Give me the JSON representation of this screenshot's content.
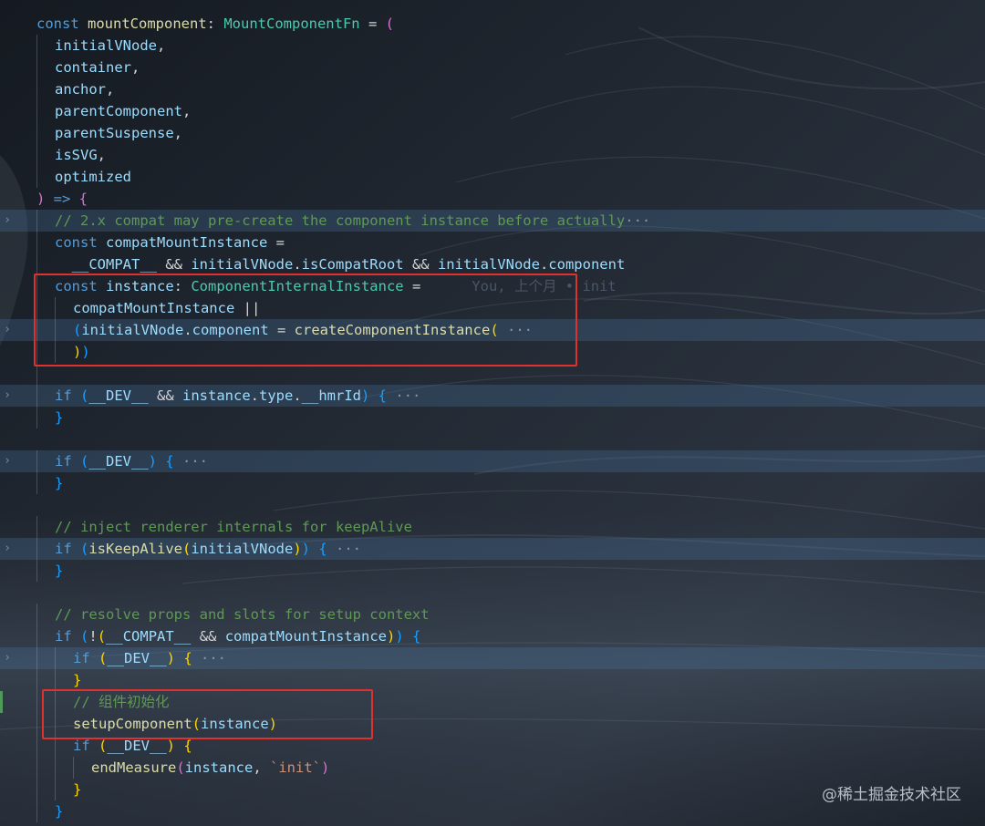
{
  "editor": {
    "lines": [
      {
        "tokens": [
          {
            "t": "const ",
            "c": "kw"
          },
          {
            "t": "mountComponent",
            "c": "fn"
          },
          {
            "t": ": ",
            "c": "pu"
          },
          {
            "t": "MountComponentFn",
            "c": "ty"
          },
          {
            "t": " = ",
            "c": "pu"
          },
          {
            "t": "(",
            "c": "b2"
          }
        ]
      },
      {
        "indent": 1,
        "tokens": [
          {
            "t": "initialVNode",
            "c": "var"
          },
          {
            "t": ",",
            "c": "pu"
          }
        ]
      },
      {
        "indent": 1,
        "tokens": [
          {
            "t": "container",
            "c": "var"
          },
          {
            "t": ",",
            "c": "pu"
          }
        ]
      },
      {
        "indent": 1,
        "tokens": [
          {
            "t": "anchor",
            "c": "var"
          },
          {
            "t": ",",
            "c": "pu"
          }
        ]
      },
      {
        "indent": 1,
        "tokens": [
          {
            "t": "parentComponent",
            "c": "var"
          },
          {
            "t": ",",
            "c": "pu"
          }
        ]
      },
      {
        "indent": 1,
        "tokens": [
          {
            "t": "parentSuspense",
            "c": "var"
          },
          {
            "t": ",",
            "c": "pu"
          }
        ]
      },
      {
        "indent": 1,
        "tokens": [
          {
            "t": "isSVG",
            "c": "var"
          },
          {
            "t": ",",
            "c": "pu"
          }
        ]
      },
      {
        "indent": 1,
        "tokens": [
          {
            "t": "optimized",
            "c": "var"
          }
        ]
      },
      {
        "tokens": [
          {
            "t": ")",
            "c": "b2"
          },
          {
            "t": " => ",
            "c": "kw"
          },
          {
            "t": "{",
            "c": "b2"
          }
        ]
      },
      {
        "indent": 1,
        "fold": true,
        "hl": true,
        "tokens": [
          {
            "t": "// 2.x compat may pre-create the component instance before actually",
            "c": "cm"
          },
          {
            "t": "···",
            "c": "fd"
          }
        ]
      },
      {
        "indent": 1,
        "tokens": [
          {
            "t": "const ",
            "c": "kw"
          },
          {
            "t": "compatMountInstance",
            "c": "var"
          },
          {
            "t": " =",
            "c": "pu"
          }
        ]
      },
      {
        "indent": 1,
        "tokens": [
          {
            "t": "  __COMPAT__ ",
            "c": "var"
          },
          {
            "t": "&& ",
            "c": "pu"
          },
          {
            "t": "initialVNode",
            "c": "var"
          },
          {
            "t": ".",
            "c": "pu"
          },
          {
            "t": "isCompatRoot",
            "c": "var"
          },
          {
            "t": " && ",
            "c": "pu"
          },
          {
            "t": "initialVNode",
            "c": "var"
          },
          {
            "t": ".",
            "c": "pu"
          },
          {
            "t": "component",
            "c": "var"
          }
        ]
      },
      {
        "indent": 1,
        "tokens": [
          {
            "t": "const ",
            "c": "kw"
          },
          {
            "t": "instance",
            "c": "var"
          },
          {
            "t": ": ",
            "c": "pu"
          },
          {
            "t": "ComponentInternalInstance",
            "c": "ty"
          },
          {
            "t": " =",
            "c": "pu"
          },
          {
            "t": "      You, 上个月 • init",
            "c": "blame"
          }
        ]
      },
      {
        "indent": 2,
        "tokens": [
          {
            "t": "compatMountInstance",
            "c": "var"
          },
          {
            "t": " ||",
            "c": "pu"
          }
        ]
      },
      {
        "indent": 2,
        "fold": true,
        "hl": true,
        "tokens": [
          {
            "t": "(",
            "c": "b3"
          },
          {
            "t": "initialVNode",
            "c": "var"
          },
          {
            "t": ".",
            "c": "pu"
          },
          {
            "t": "component",
            "c": "var"
          },
          {
            "t": " = ",
            "c": "pu"
          },
          {
            "t": "createComponentInstance",
            "c": "fn"
          },
          {
            "t": "(",
            "c": "b1"
          },
          {
            "t": " ···",
            "c": "fd"
          }
        ]
      },
      {
        "indent": 2,
        "tokens": [
          {
            "t": ")",
            "c": "b1"
          },
          {
            "t": ")",
            "c": "b3"
          }
        ]
      },
      {
        "indent": 1,
        "tokens": []
      },
      {
        "indent": 1,
        "fold": true,
        "hl": true,
        "tokens": [
          {
            "t": "if ",
            "c": "ctl"
          },
          {
            "t": "(",
            "c": "b3"
          },
          {
            "t": "__DEV__",
            "c": "var"
          },
          {
            "t": " && ",
            "c": "pu"
          },
          {
            "t": "instance",
            "c": "var"
          },
          {
            "t": ".",
            "c": "pu"
          },
          {
            "t": "type",
            "c": "var"
          },
          {
            "t": ".",
            "c": "pu"
          },
          {
            "t": "__hmrId",
            "c": "var"
          },
          {
            "t": ")",
            "c": "b3"
          },
          {
            "t": " {",
            "c": "b3"
          },
          {
            "t": " ···",
            "c": "fd"
          }
        ]
      },
      {
        "indent": 1,
        "tokens": [
          {
            "t": "}",
            "c": "b3"
          }
        ]
      },
      {
        "tokens": []
      },
      {
        "indent": 1,
        "fold": true,
        "hl": true,
        "tokens": [
          {
            "t": "if ",
            "c": "ctl"
          },
          {
            "t": "(",
            "c": "b3"
          },
          {
            "t": "__DEV__",
            "c": "var"
          },
          {
            "t": ")",
            "c": "b3"
          },
          {
            "t": " {",
            "c": "b3"
          },
          {
            "t": " ···",
            "c": "fd"
          }
        ]
      },
      {
        "indent": 1,
        "tokens": [
          {
            "t": "}",
            "c": "b3"
          }
        ]
      },
      {
        "tokens": []
      },
      {
        "indent": 1,
        "tokens": [
          {
            "t": "// inject renderer internals for keepAlive",
            "c": "cm"
          }
        ]
      },
      {
        "indent": 1,
        "fold": true,
        "hl": true,
        "tokens": [
          {
            "t": "if ",
            "c": "ctl"
          },
          {
            "t": "(",
            "c": "b3"
          },
          {
            "t": "isKeepAlive",
            "c": "fn"
          },
          {
            "t": "(",
            "c": "b1"
          },
          {
            "t": "initialVNode",
            "c": "var"
          },
          {
            "t": ")",
            "c": "b1"
          },
          {
            "t": ")",
            "c": "b3"
          },
          {
            "t": " {",
            "c": "b3"
          },
          {
            "t": " ···",
            "c": "fd"
          }
        ]
      },
      {
        "indent": 1,
        "tokens": [
          {
            "t": "}",
            "c": "b3"
          }
        ]
      },
      {
        "tokens": []
      },
      {
        "indent": 1,
        "tokens": [
          {
            "t": "// resolve props and slots for setup context",
            "c": "cm"
          }
        ]
      },
      {
        "indent": 1,
        "tokens": [
          {
            "t": "if ",
            "c": "ctl"
          },
          {
            "t": "(",
            "c": "b3"
          },
          {
            "t": "!",
            "c": "pu"
          },
          {
            "t": "(",
            "c": "b1"
          },
          {
            "t": "__COMPAT__",
            "c": "var"
          },
          {
            "t": " && ",
            "c": "pu"
          },
          {
            "t": "compatMountInstance",
            "c": "var"
          },
          {
            "t": ")",
            "c": "b1"
          },
          {
            "t": ")",
            "c": "b3"
          },
          {
            "t": " {",
            "c": "b3"
          }
        ]
      },
      {
        "indent": 2,
        "fold": true,
        "hl": true,
        "tokens": [
          {
            "t": "if ",
            "c": "ctl"
          },
          {
            "t": "(",
            "c": "b1"
          },
          {
            "t": "__DEV__",
            "c": "var"
          },
          {
            "t": ")",
            "c": "b1"
          },
          {
            "t": " {",
            "c": "b1"
          },
          {
            "t": " ···",
            "c": "fd"
          }
        ]
      },
      {
        "indent": 2,
        "tokens": [
          {
            "t": "}",
            "c": "b1"
          }
        ]
      },
      {
        "indent": 2,
        "changed": true,
        "tokens": [
          {
            "t": "// 组件初始化",
            "c": "cm"
          }
        ]
      },
      {
        "indent": 2,
        "tokens": [
          {
            "t": "setupComponent",
            "c": "fn"
          },
          {
            "t": "(",
            "c": "b1"
          },
          {
            "t": "instance",
            "c": "var"
          },
          {
            "t": ")",
            "c": "b1"
          }
        ]
      },
      {
        "indent": 2,
        "tokens": [
          {
            "t": "if ",
            "c": "ctl"
          },
          {
            "t": "(",
            "c": "b1"
          },
          {
            "t": "__DEV__",
            "c": "var"
          },
          {
            "t": ")",
            "c": "b1"
          },
          {
            "t": " {",
            "c": "b1"
          }
        ]
      },
      {
        "indent": 3,
        "tokens": [
          {
            "t": "endMeasure",
            "c": "fn"
          },
          {
            "t": "(",
            "c": "b2"
          },
          {
            "t": "instance",
            "c": "var"
          },
          {
            "t": ", ",
            "c": "pu"
          },
          {
            "t": "`init`",
            "c": "st"
          },
          {
            "t": ")",
            "c": "b2"
          }
        ]
      },
      {
        "indent": 2,
        "tokens": [
          {
            "t": "}",
            "c": "b1"
          }
        ]
      },
      {
        "indent": 1,
        "tokens": [
          {
            "t": "}",
            "c": "b3"
          }
        ]
      }
    ]
  },
  "icons": {
    "fold": "chevron-right-icon",
    "glyph": "›"
  },
  "colors": {
    "annotation_box": "#e0312e",
    "background": "#1b2028"
  },
  "watermark": "@稀土掘金技术社区"
}
